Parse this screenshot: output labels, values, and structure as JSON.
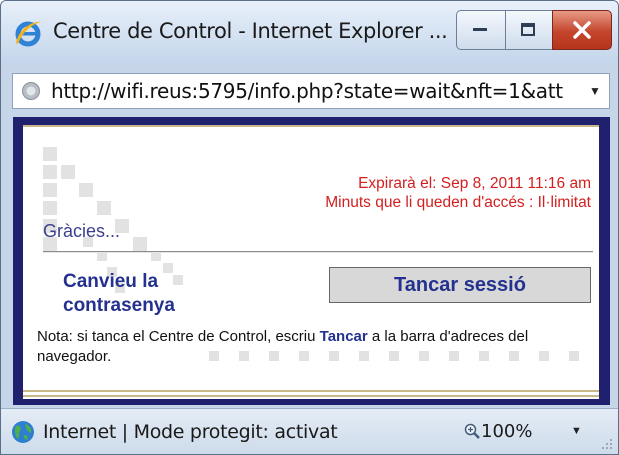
{
  "window": {
    "title": "Centre de Control - Internet Explorer ...",
    "icon": "internet-explorer-icon",
    "controls": {
      "minimize": "minimize-icon",
      "maximize": "maximize-icon",
      "close": "close-icon"
    }
  },
  "address": {
    "url": "http://wifi.reus:5795/info.php?state=wait&nft=1&att",
    "icon": "page-icon"
  },
  "page": {
    "expiry_line1": "Expirarà el: Sep 8, 2011 11:16 am",
    "expiry_line2": "Minuts que li queden d'accés : Il·limitat",
    "thanks": "Gràcies...",
    "change_password": "Canvieu la contrasenya",
    "logout_button": "Tancar sessió",
    "note_before": "Nota: si tanca el Centre de Control, escriu ",
    "note_keyword": "Tancar",
    "note_after": " a la barra d'adreces del navegador."
  },
  "status": {
    "zone": "Internet | Mode protegit: activat",
    "zoom": "100%",
    "globe_icon": "globe-icon",
    "zoom_icon": "magnifier-icon"
  },
  "colors": {
    "frame": "#20216e",
    "link": "#24318e",
    "expiry": "#d22020",
    "accent_band": "#c9b98a"
  }
}
